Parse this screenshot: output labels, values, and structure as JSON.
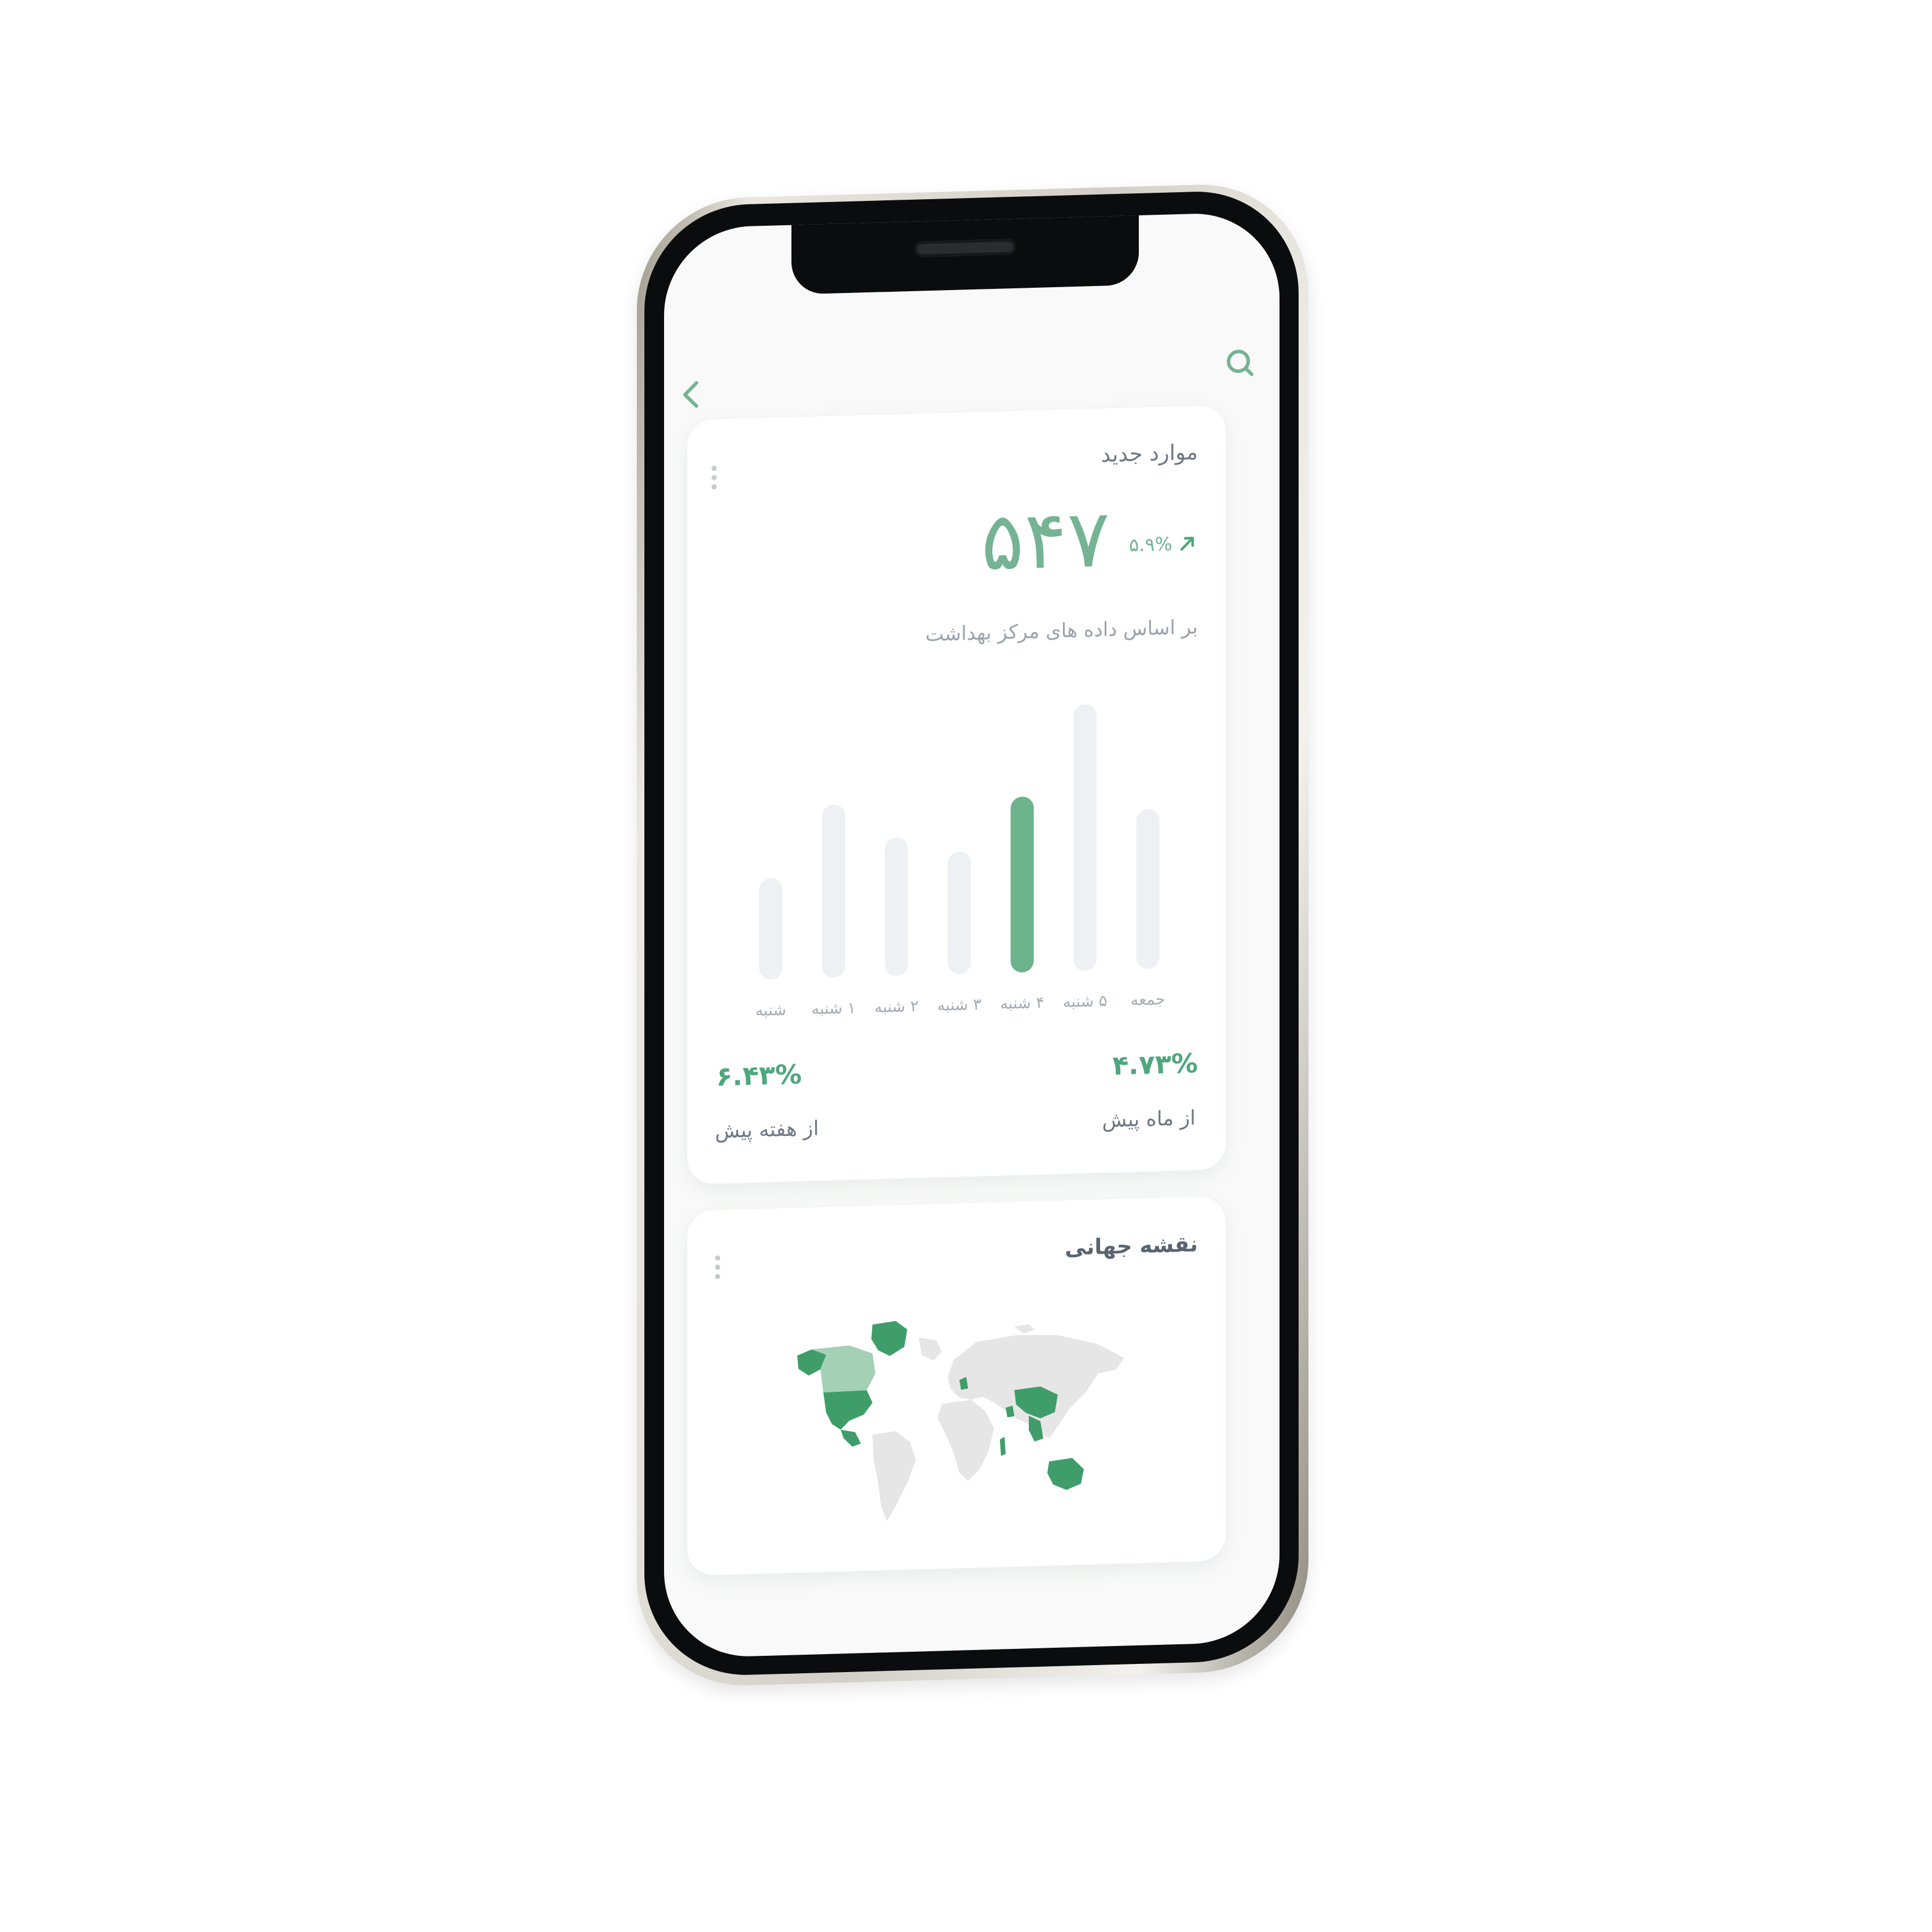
{
  "header": {
    "back_icon": "chevron-left-icon",
    "search_icon": "search-icon"
  },
  "new_cases": {
    "title": "موارد جدید",
    "value": "۵۴۷",
    "change": "۵.۹%",
    "change_icon": "arrow-up-right-icon",
    "subtitle": "بر اساس داده های مرکز بهداشت",
    "stats": [
      {
        "value": "۴.۷۳%",
        "label": "از ماه پیش"
      },
      {
        "value": "۶.۴۳%",
        "label": "از هفته پیش"
      }
    ]
  },
  "chart_data": {
    "type": "bar",
    "categories": [
      "شنبه",
      "۱ شنبه",
      "۲ شنبه",
      "۳ شنبه",
      "۴ شنبه",
      "۵ شنبه",
      "جمعه"
    ],
    "values": [
      38,
      65,
      52,
      46,
      66,
      100,
      60
    ],
    "highlighted_category": "۴ شنبه",
    "ylim": [
      0,
      100
    ],
    "grid": false,
    "colors": {
      "bar": "#eff0f3",
      "highlight": "#6db38c"
    }
  },
  "world_map": {
    "title": "نقشه جهانی",
    "colors": {
      "land": "#e6e6e6",
      "highlight": "#3f9d6a",
      "light": "#a4d0b6"
    }
  }
}
